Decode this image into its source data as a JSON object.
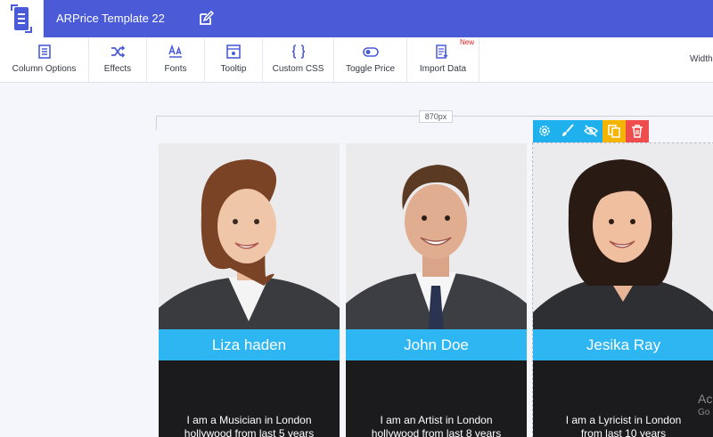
{
  "header": {
    "title": "ARPrice Template 22",
    "logo_icon": "arprice-logo-icon",
    "edit_icon": "pencil-square-icon",
    "background": "#4b5bd8"
  },
  "toolbar": {
    "items": [
      {
        "label": "Column Options",
        "icon": "column-list-icon"
      },
      {
        "label": "Effects",
        "icon": "shuffle-icon"
      },
      {
        "label": "Fonts",
        "icon": "font-icon"
      },
      {
        "label": "Tooltip",
        "icon": "tooltip-window-icon"
      },
      {
        "label": "Custom CSS",
        "icon": "curly-braces-icon"
      },
      {
        "label": "Toggle Price",
        "icon": "toggle-icon"
      },
      {
        "label": "Import Data",
        "icon": "import-data-icon",
        "badge": "New"
      }
    ],
    "width_label": "Width"
  },
  "canvas": {
    "ruler_label": "870px",
    "column_actions": [
      {
        "icon": "gear-icon",
        "color": "#1fb1ee"
      },
      {
        "icon": "brush-icon",
        "color": "#1fb1ee"
      },
      {
        "icon": "eye-slash-icon",
        "color": "#1fb1ee"
      },
      {
        "icon": "copy-icon",
        "color": "#f4b400"
      },
      {
        "icon": "trash-icon",
        "color": "#ef4d4d"
      }
    ]
  },
  "cards": [
    {
      "name": "Liza haden",
      "desc_line1": "I am a Musician in London",
      "desc_line2": "hollywood from last 5 years"
    },
    {
      "name": "John Doe",
      "desc_line1": "I am an Artist in London",
      "desc_line2": "hollywood from last 8 years"
    },
    {
      "name": "Jesika Ray",
      "desc_line1": "I am a Lyricist in London",
      "desc_line2": "from last 10 years"
    }
  ],
  "watermark": {
    "line1": "Ac",
    "line2": "Go"
  },
  "colors": {
    "accent": "#2eb6f2",
    "dark": "#1b1b1d",
    "toolbar_icon": "#4b5bd8"
  }
}
